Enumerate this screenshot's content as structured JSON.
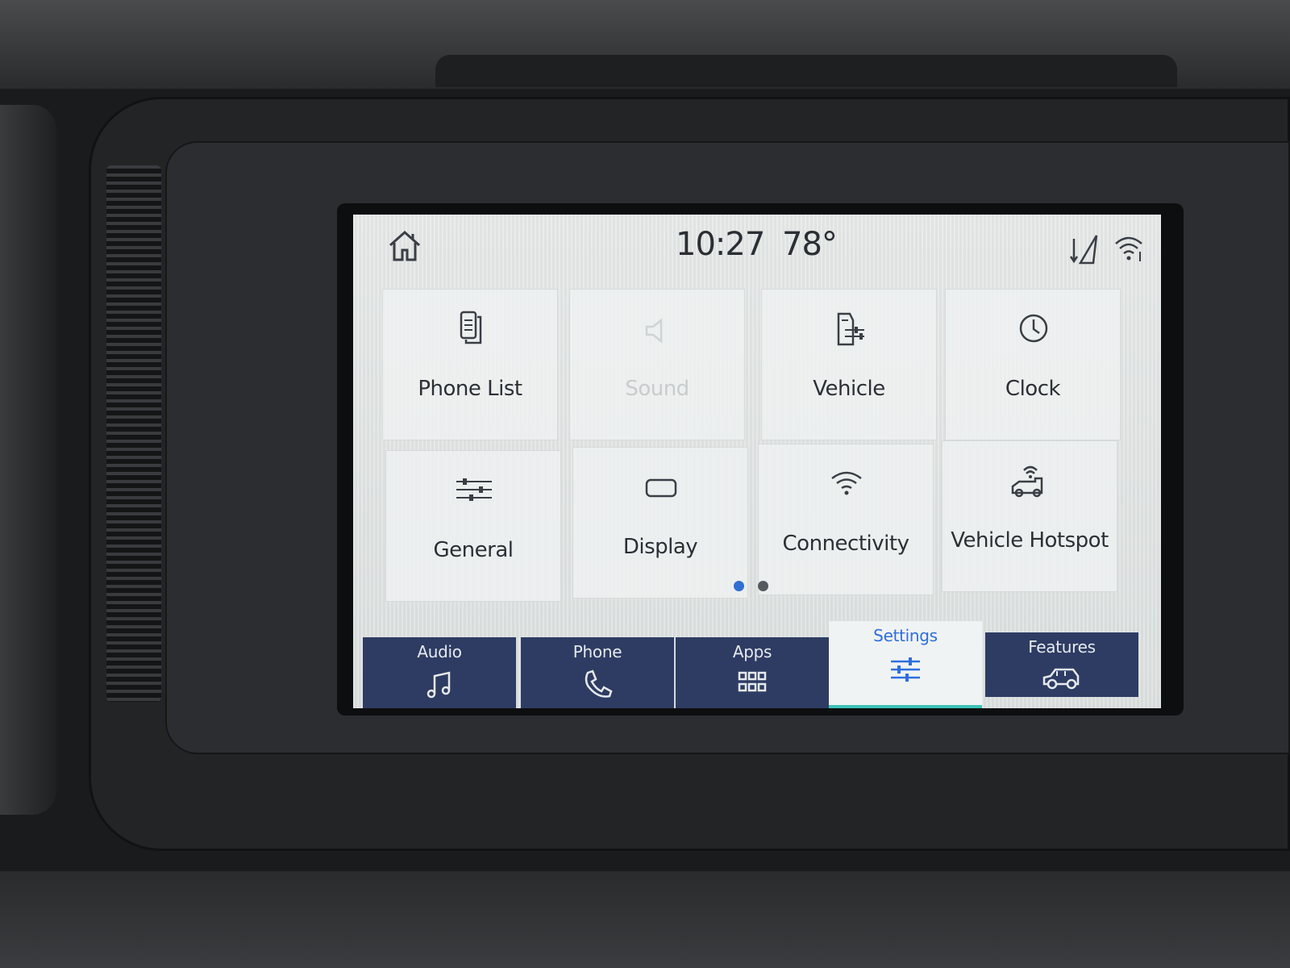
{
  "status_bar": {
    "time": "10:27",
    "temperature": "78°"
  },
  "tiles": [
    {
      "label": "Phone List",
      "icon": "phone-list-icon"
    },
    {
      "label": "Sound",
      "icon": "sound-icon"
    },
    {
      "label": "Vehicle",
      "icon": "vehicle-settings-icon"
    },
    {
      "label": "Clock",
      "icon": "clock-icon"
    },
    {
      "label": "General",
      "icon": "sliders-icon"
    },
    {
      "label": "Display",
      "icon": "display-icon"
    },
    {
      "label": "Connectivity",
      "icon": "wifi-icon"
    },
    {
      "label": "Vehicle Hotspot",
      "icon": "vehicle-hotspot-icon"
    }
  ],
  "pager": {
    "current_page": 1,
    "total_pages": 2
  },
  "bottom_nav": {
    "active": "Settings",
    "tabs": [
      {
        "label": "Audio",
        "icon": "music-note-icon"
      },
      {
        "label": "Phone",
        "icon": "phone-icon"
      },
      {
        "label": "Apps",
        "icon": "apps-grid-icon"
      },
      {
        "label": "Settings",
        "icon": "settings-sliders-icon"
      },
      {
        "label": "Features",
        "icon": "car-icon"
      }
    ]
  },
  "colors": {
    "nav_background": "#2e3c63",
    "active_tab_text": "#2e6fe0",
    "active_tab_underline": "#3cc2b8",
    "active_dot": "#2f6fd3"
  }
}
